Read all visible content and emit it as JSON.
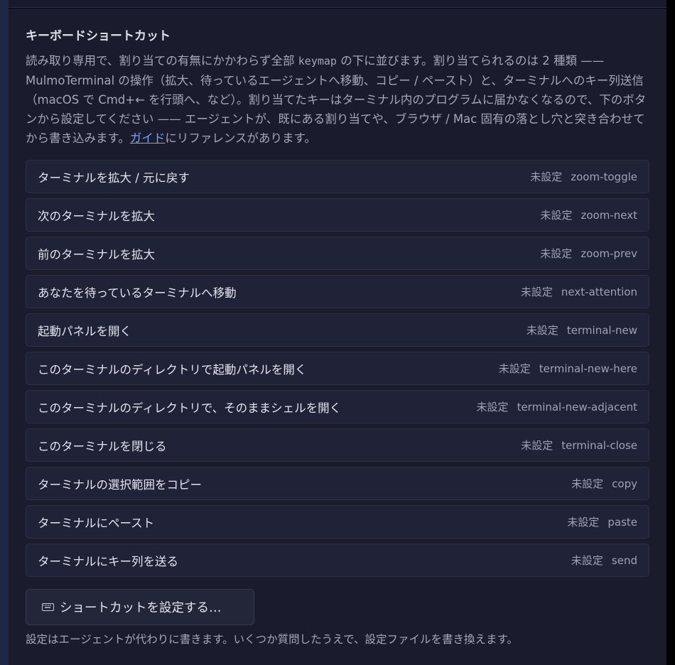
{
  "section": {
    "title": "キーボードショートカット",
    "description_parts": {
      "p1": "読み取り専用で、割り当ての有無にかかわらず全部 ",
      "keymap": "keymap",
      "p2": " の下に並びます。割り当てられるのは 2 種類 —— MulmoTerminal の操作（拡大、待っているエージェントへ移動、コピー / ペースト）と、ターミナルへのキー列送信（macOS で Cmd+← を行頭へ、など）。割り当てたキーはターミナル内のプログラムに届かなくなるので、下のボタンから設定してください —— エージェントが、既にある割り当てや、ブラウザ / Mac 固有の落とし穴と突き合わせてから書き込みます。",
      "guide_link": "ガイド",
      "p3": "にリファレンスがあります。"
    }
  },
  "shortcuts": [
    {
      "label": "ターミナルを拡大 / 元に戻す",
      "status": "未設定",
      "id": "zoom-toggle"
    },
    {
      "label": "次のターミナルを拡大",
      "status": "未設定",
      "id": "zoom-next"
    },
    {
      "label": "前のターミナルを拡大",
      "status": "未設定",
      "id": "zoom-prev"
    },
    {
      "label": "あなたを待っているターミナルへ移動",
      "status": "未設定",
      "id": "next-attention"
    },
    {
      "label": "起動パネルを開く",
      "status": "未設定",
      "id": "terminal-new"
    },
    {
      "label": "このターミナルのディレクトリで起動パネルを開く",
      "status": "未設定",
      "id": "terminal-new-here"
    },
    {
      "label": "このターミナルのディレクトリで、そのままシェルを開く",
      "status": "未設定",
      "id": "terminal-new-adjacent"
    },
    {
      "label": "このターミナルを閉じる",
      "status": "未設定",
      "id": "terminal-close"
    },
    {
      "label": "ターミナルの選択範囲をコピー",
      "status": "未設定",
      "id": "copy"
    },
    {
      "label": "ターミナルにペースト",
      "status": "未設定",
      "id": "paste"
    },
    {
      "label": "ターミナルにキー列を送る",
      "status": "未設定",
      "id": "send"
    }
  ],
  "config_button": {
    "label": "ショートカットを設定する…",
    "icon": "keyboard-icon"
  },
  "footer": {
    "note": "設定はエージェントが代わりに書きます。いくつか質問したうえで、設定ファイルを書き換えます。"
  },
  "colors": {
    "panel_bg": "#1a1b2d",
    "row_bg": "#202238",
    "link": "#6ea8ff",
    "accent_strip": "#1d2746"
  }
}
